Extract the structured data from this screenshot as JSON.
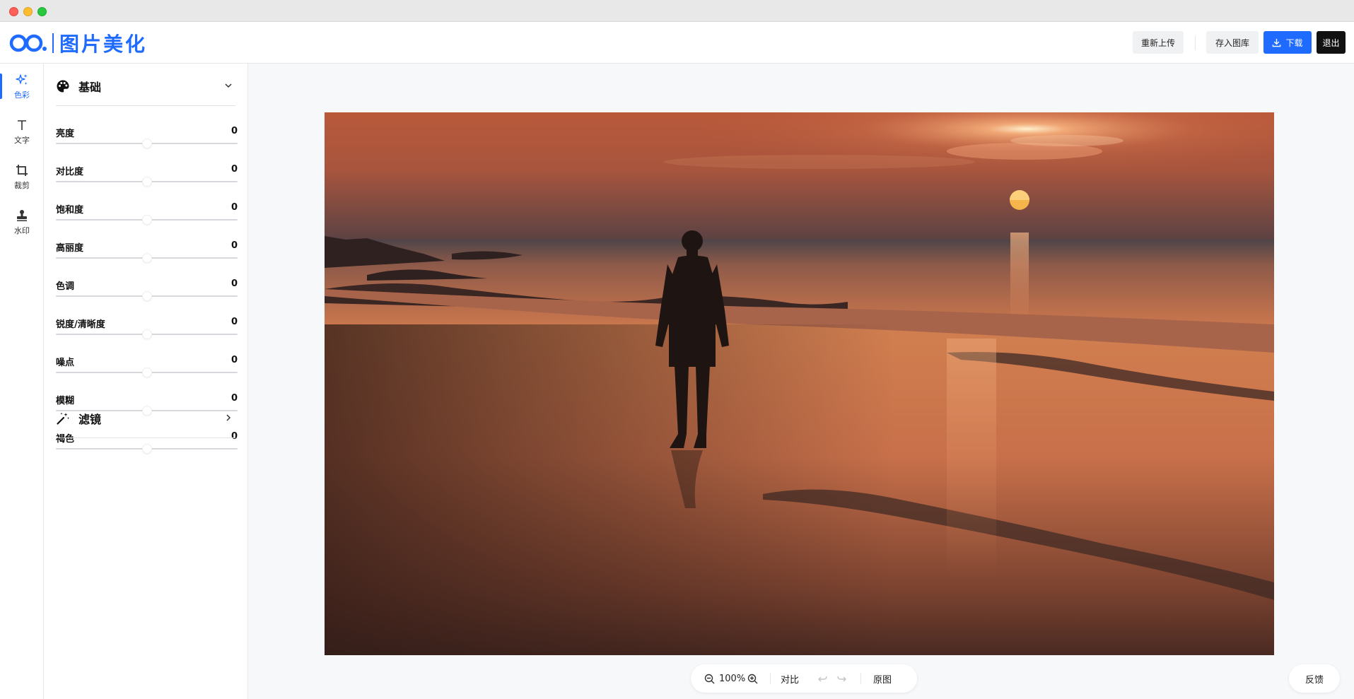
{
  "app": {
    "title": "图片美化",
    "brand_color": "#1f6bff"
  },
  "header": {
    "reupload_label": "重新上传",
    "save_to_gallery_label": "存入图库",
    "download_label": "下载",
    "exit_label": "退出"
  },
  "leftnav": {
    "items": [
      {
        "label": "色彩",
        "icon": "sparkles-icon",
        "active": true
      },
      {
        "label": "文字",
        "icon": "text-icon",
        "active": false
      },
      {
        "label": "裁剪",
        "icon": "crop-icon",
        "active": false
      },
      {
        "label": "水印",
        "icon": "stamp-icon",
        "active": false
      }
    ]
  },
  "panel": {
    "basic": {
      "title": "基础",
      "icon": "palette-icon",
      "expanded": true,
      "sliders": [
        {
          "label": "亮度",
          "value": "0",
          "level": 0.5
        },
        {
          "label": "对比度",
          "value": "0",
          "level": 0.5
        },
        {
          "label": "饱和度",
          "value": "0",
          "level": 0.5
        },
        {
          "label": "高丽度",
          "value": "0",
          "level": 0.5
        },
        {
          "label": "色调",
          "value": "0",
          "level": 0.5
        },
        {
          "label": "锐度/清晰度",
          "value": "0",
          "level": 0.5
        },
        {
          "label": "噪点",
          "value": "0",
          "level": 0.5
        },
        {
          "label": "模糊",
          "value": "0",
          "level": 0.5
        },
        {
          "label": "褐色",
          "value": "0",
          "level": 0.5
        }
      ]
    },
    "filters": {
      "title": "滤镜",
      "icon": "magic-wand-icon",
      "expanded": false
    }
  },
  "bottombar": {
    "zoom": "100%",
    "compare_label": "对比",
    "original_label": "原图"
  },
  "feedback_label": "反馈"
}
